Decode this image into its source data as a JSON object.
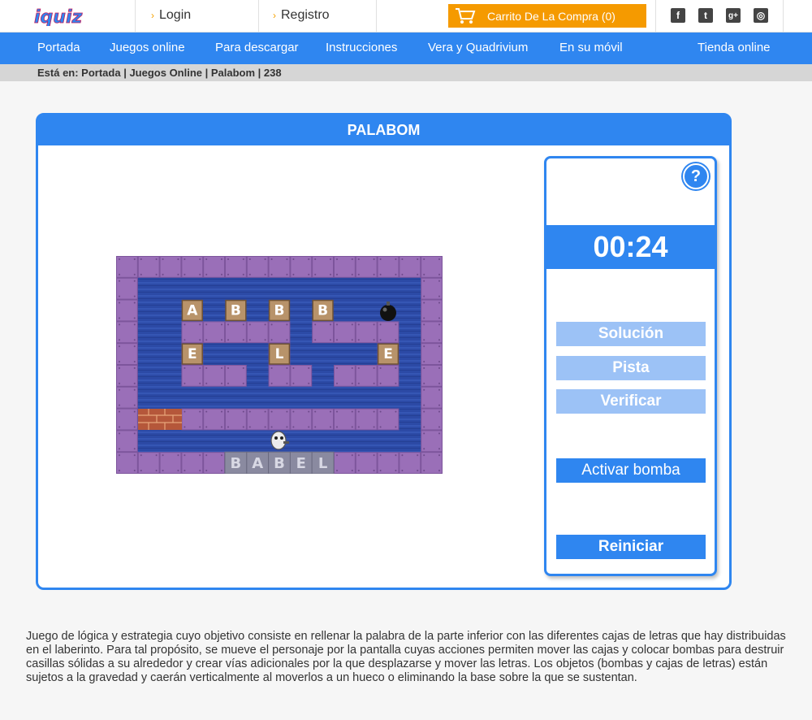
{
  "header": {
    "logo_text": "iquiz",
    "login_label": "Login",
    "register_label": "Registro",
    "cart_label": "Carrito De La Compra (0)",
    "social": [
      {
        "icon": "facebook-icon",
        "glyph": "f"
      },
      {
        "icon": "twitter-icon",
        "glyph": "t"
      },
      {
        "icon": "google-plus-icon",
        "glyph": "g+"
      },
      {
        "icon": "instagram-icon",
        "glyph": "◎"
      }
    ]
  },
  "nav": {
    "items": [
      "Portada",
      "Juegos online",
      "Para descargar",
      "Instrucciones",
      "Vera y Quadrivium",
      "En su móvil",
      "Tienda online"
    ]
  },
  "breadcrumb": "Está en: Portada | Juegos Online | Palabom | 238",
  "game": {
    "title": "PALABOM",
    "letters": [
      "A",
      "B",
      "B",
      "B",
      "E",
      "L",
      "E"
    ],
    "target_word": [
      "B",
      "A",
      "B",
      "E",
      "L"
    ]
  },
  "side": {
    "help_label": "?",
    "timer": "00:24",
    "solution_label": "Solución",
    "hint_label": "Pista",
    "verify_label": "Verificar",
    "bomb_label": "Activar bomba",
    "restart_label": "Reiniciar"
  },
  "description": "Juego de lógica y estrategia cuyo objetivo consiste en rellenar la palabra de la parte inferior con las diferentes cajas de letras que hay distribuidas en el laberinto. Para tal propósito, se mueve el personaje por la pantalla cuyas acciones permiten mover las cajas y colocar bombas para destruir casillas sólidas a su alrededor y crear vías adicionales por la que desplazarse y mover las letras. Los objetos (bombas y cajas de letras) están sujetos a la gravedad y caerán verticalmente al moverlos a un hueco o eliminando la base sobre la que se sustentan.",
  "colors": {
    "accent": "#2f86f0",
    "cart": "#f59a00",
    "wall": "#9a6fb8",
    "water": "#2c4aa6"
  }
}
